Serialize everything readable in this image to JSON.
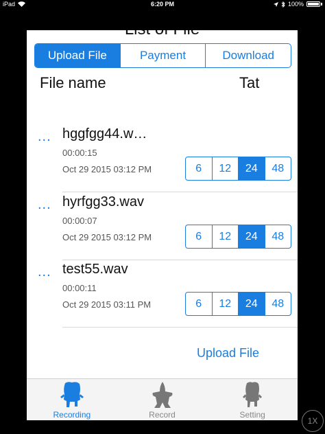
{
  "status_bar": {
    "device": "iPad",
    "time": "6:20 PM",
    "battery": "100%"
  },
  "header": {
    "title": "List of File"
  },
  "segments": [
    {
      "label": "Upload File",
      "active": true
    },
    {
      "label": "Payment",
      "active": false
    },
    {
      "label": "Download",
      "active": false
    }
  ],
  "columns": {
    "file_name": "File name",
    "tat": "Tat"
  },
  "files": [
    {
      "more": "...",
      "name": "hggfgg44.w…",
      "duration": "00:00:15",
      "date": "Oct 29 2015 03:12 PM",
      "tat_options": [
        "6",
        "12",
        "24",
        "48"
      ],
      "tat_selected": "24"
    },
    {
      "more": "...",
      "name": "hyrfgg33.wav",
      "duration": "00:00:07",
      "date": "Oct 29 2015 03:12 PM",
      "tat_options": [
        "6",
        "12",
        "24",
        "48"
      ],
      "tat_selected": "24"
    },
    {
      "more": "...",
      "name": "test55.wav",
      "duration": "00:00:11",
      "date": "Oct 29 2015 03:11 PM",
      "tat_options": [
        "6",
        "12",
        "24",
        "48"
      ],
      "tat_selected": "24"
    }
  ],
  "upload_link": "Upload File",
  "tabs": [
    {
      "label": "Recording",
      "icon": "sponge-character-icon",
      "active": true
    },
    {
      "label": "Record",
      "icon": "starfish-character-icon",
      "active": false
    },
    {
      "label": "Setting",
      "icon": "sponge-character-icon",
      "active": false
    }
  ],
  "zoom_button": "1X",
  "colors": {
    "accent": "#1a7de0",
    "tab_inactive": "#888888"
  }
}
